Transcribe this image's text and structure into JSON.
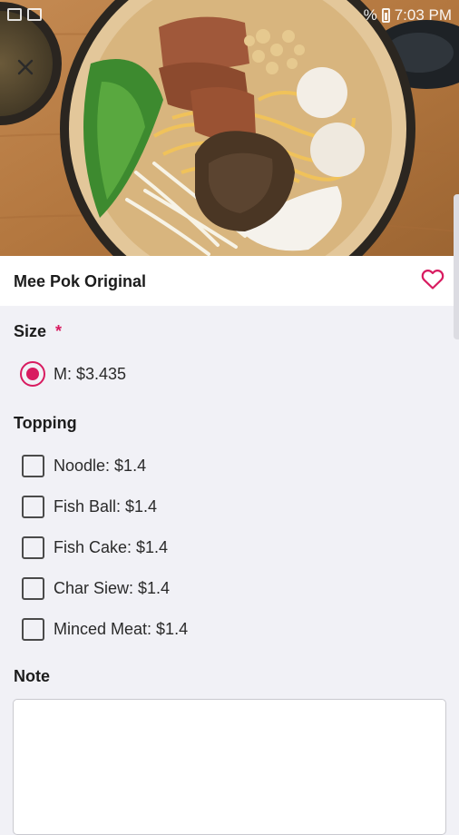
{
  "status_bar": {
    "battery_text": "%",
    "time": "7:03 PM"
  },
  "product": {
    "name": "Mee Pok Original",
    "image_icon": "noodle-bowl-photo",
    "favorite_icon": "heart-outline-icon",
    "close_icon": "close-icon"
  },
  "size": {
    "title": "Size",
    "required_mark": "*",
    "options": [
      {
        "label": "M: $3.435",
        "selected": true
      }
    ]
  },
  "topping": {
    "title": "Topping",
    "options": [
      {
        "label": "Noodle: $1.4",
        "checked": false
      },
      {
        "label": "Fish Ball: $1.4",
        "checked": false
      },
      {
        "label": "Fish Cake: $1.4",
        "checked": false
      },
      {
        "label": "Char Siew: $1.4",
        "checked": false
      },
      {
        "label": "Minced Meat: $1.4",
        "checked": false
      }
    ]
  },
  "note": {
    "title": "Note",
    "value": "",
    "placeholder": ""
  },
  "colors": {
    "accent": "#d81b60",
    "background": "#f1f1f6"
  }
}
